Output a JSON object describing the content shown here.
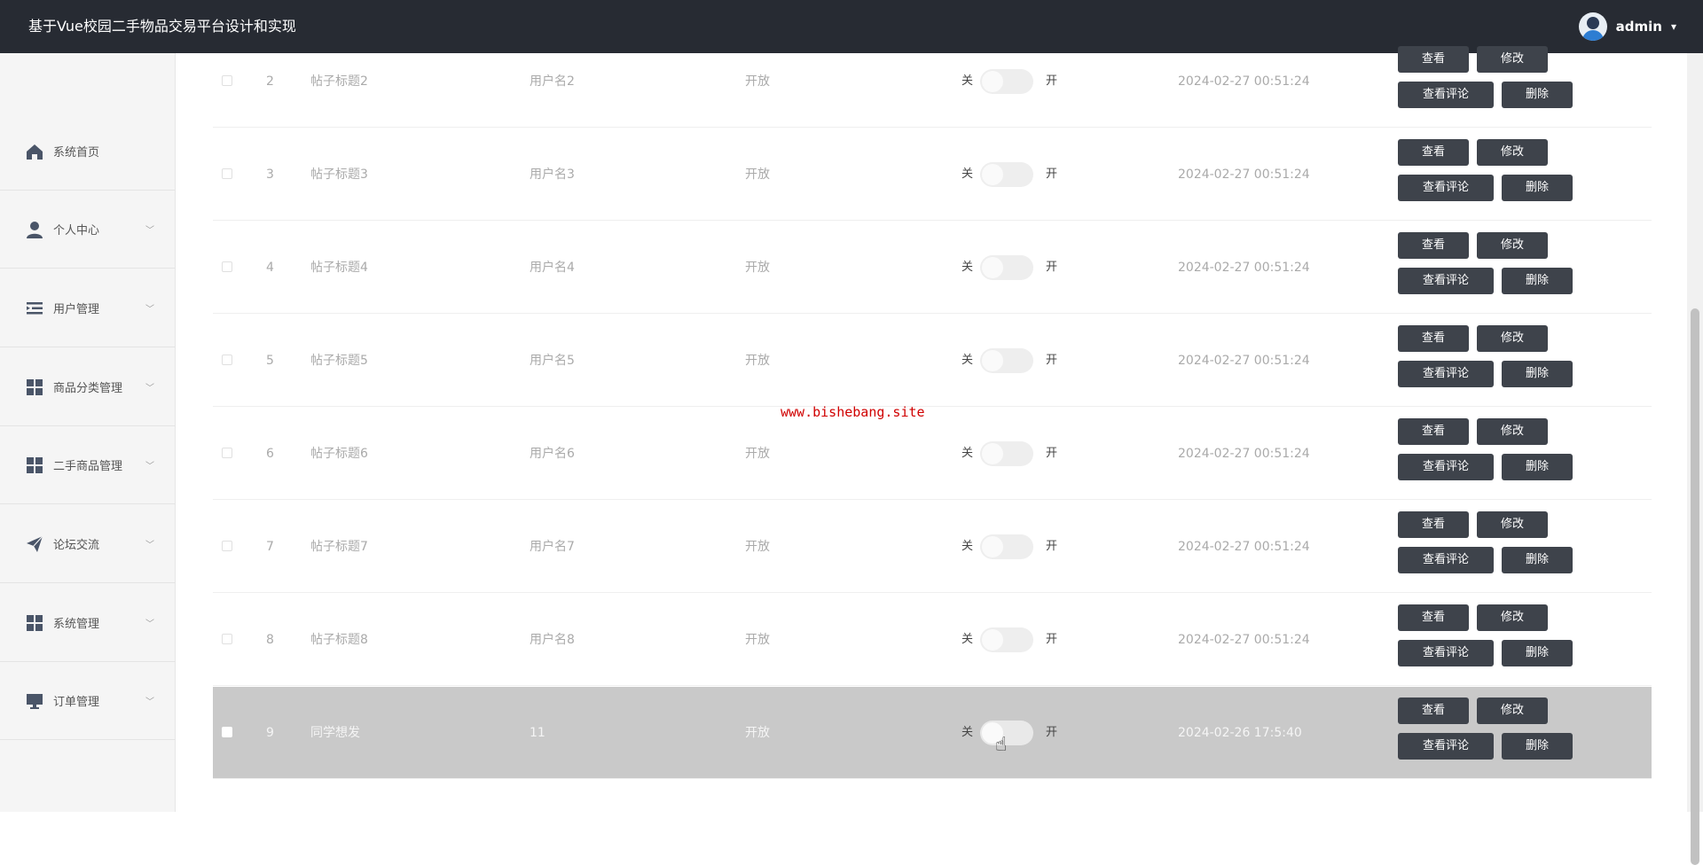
{
  "header": {
    "title": "基于Vue校园二手物品交易平台设计和实现",
    "user": "admin",
    "caret": "▾"
  },
  "sidebar": {
    "items": [
      {
        "label": "系统首页",
        "icon": "home-icon",
        "has_submenu": false
      },
      {
        "label": "个人中心",
        "icon": "person-icon",
        "has_submenu": true
      },
      {
        "label": "用户管理",
        "icon": "list-indent-icon",
        "has_submenu": true
      },
      {
        "label": "商品分类管理",
        "icon": "grid-icon",
        "has_submenu": true
      },
      {
        "label": "二手商品管理",
        "icon": "grid-icon",
        "has_submenu": true
      },
      {
        "label": "论坛交流",
        "icon": "paper-plane-icon",
        "has_submenu": true
      },
      {
        "label": "系统管理",
        "icon": "grid-icon",
        "has_submenu": true
      },
      {
        "label": "订单管理",
        "icon": "monitor-icon",
        "has_submenu": true
      }
    ]
  },
  "table": {
    "switch_off_label": "关",
    "switch_on_label": "开",
    "actions": {
      "view": "查看",
      "edit": "修改",
      "view_comments": "查看评论",
      "delete": "删除"
    },
    "rows": [
      {
        "index": "2",
        "title": "帖子标题2",
        "user": "用户名2",
        "status": "开放",
        "time": "2024-02-27 00:51:24"
      },
      {
        "index": "3",
        "title": "帖子标题3",
        "user": "用户名3",
        "status": "开放",
        "time": "2024-02-27 00:51:24"
      },
      {
        "index": "4",
        "title": "帖子标题4",
        "user": "用户名4",
        "status": "开放",
        "time": "2024-02-27 00:51:24"
      },
      {
        "index": "5",
        "title": "帖子标题5",
        "user": "用户名5",
        "status": "开放",
        "time": "2024-02-27 00:51:24"
      },
      {
        "index": "6",
        "title": "帖子标题6",
        "user": "用户名6",
        "status": "开放",
        "time": "2024-02-27 00:51:24"
      },
      {
        "index": "7",
        "title": "帖子标题7",
        "user": "用户名7",
        "status": "开放",
        "time": "2024-02-27 00:51:24"
      },
      {
        "index": "8",
        "title": "帖子标题8",
        "user": "用户名8",
        "status": "开放",
        "time": "2024-02-27 00:51:24"
      },
      {
        "index": "9",
        "title": "同学想发",
        "user": "11",
        "status": "开放",
        "time": "2024-02-26 17:5:40"
      }
    ]
  },
  "watermark": "www.bishebang.site",
  "colors": {
    "header_bg": "#272b33",
    "button_bg": "#3e434b",
    "highlight_row": "#c9c9c9",
    "watermark": "#d00000"
  }
}
